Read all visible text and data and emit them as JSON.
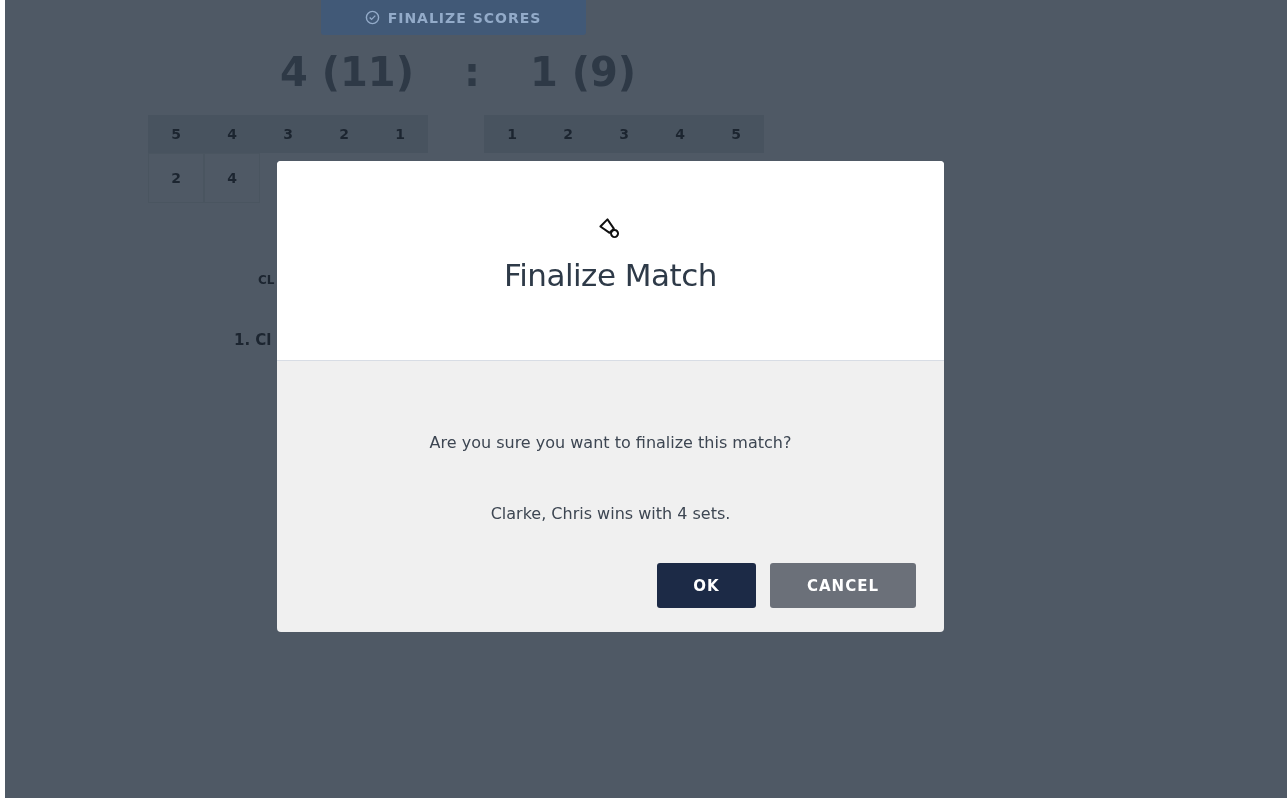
{
  "background": {
    "finalize_button": "FINALIZE SCORES",
    "score_left": "4 (11)",
    "score_separator": ":",
    "score_right": "1 (9)",
    "left_table": {
      "header": [
        "5",
        "4",
        "3",
        "2",
        "1"
      ],
      "row": [
        "2",
        "4"
      ]
    },
    "right_table": {
      "header": [
        "1",
        "2",
        "3",
        "4",
        "5"
      ]
    },
    "label": "CL",
    "list_item": "1. Cl"
  },
  "dialog": {
    "title": "Finalize Match",
    "message": "Are you sure you want to finalize this match?",
    "detail": "Clarke, Chris wins with 4 sets.",
    "buttons": [
      {
        "label": "OK",
        "kind": "primary"
      },
      {
        "label": "CANCEL",
        "kind": "secondary"
      }
    ]
  }
}
